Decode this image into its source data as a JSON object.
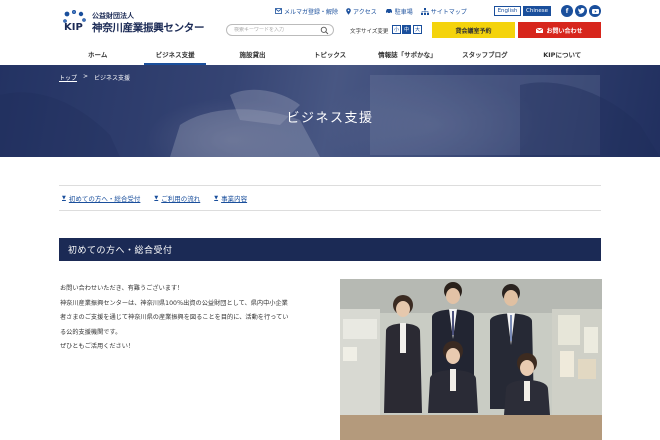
{
  "header": {
    "logo_sub": "公益財団法人",
    "logo_main": "神奈川産業振興センター",
    "logo_mark": "KIP",
    "top_links": [
      {
        "label": "メルマガ登録・解除",
        "icon": "mail-icon"
      },
      {
        "label": "アクセス",
        "icon": "map-pin-icon"
      },
      {
        "label": "駐車場",
        "icon": "car-icon"
      },
      {
        "label": "サイトマップ",
        "icon": "sitemap-icon"
      }
    ],
    "lang_en": "English",
    "lang_zh": "Chinese",
    "search_placeholder": "検索キーワードを入力",
    "font_size_label": "文字サイズ変更",
    "font_sizes": [
      "小",
      "中",
      "大"
    ],
    "reserve_button": "貸会議室予約",
    "contact_button": "お問い合わせ"
  },
  "nav": {
    "items": [
      "ホーム",
      "ビジネス支援",
      "施設貸出",
      "トピックス",
      "情報誌「サポかな」",
      "スタッフブログ",
      "KIPについて"
    ],
    "active_index": 1
  },
  "hero": {
    "breadcrumb_home": "トップ",
    "breadcrumb_sep": ">",
    "breadcrumb_current": "ビジネス支援",
    "title": "ビジネス支援"
  },
  "anchors": [
    "初めての方へ・総合受付",
    "ご利用の流れ",
    "事業内容"
  ],
  "section": {
    "title": "初めての方へ・総合受付",
    "lines": [
      "お問い合わせいただき、有難うございます！",
      "神奈川産業振興センターは、神奈川県100％出資の公益財団として、県内中小企業",
      "者さまのご支援を通じて神奈川県の産業振興を図ることを目的に、活動を行ってい",
      "る公的支援機関です。",
      "ぜひともご活用ください！"
    ]
  },
  "colors": {
    "navy": "#1b2a55",
    "link_blue": "#1a4f9c",
    "yellow": "#f4d30c",
    "red": "#d7261c"
  }
}
